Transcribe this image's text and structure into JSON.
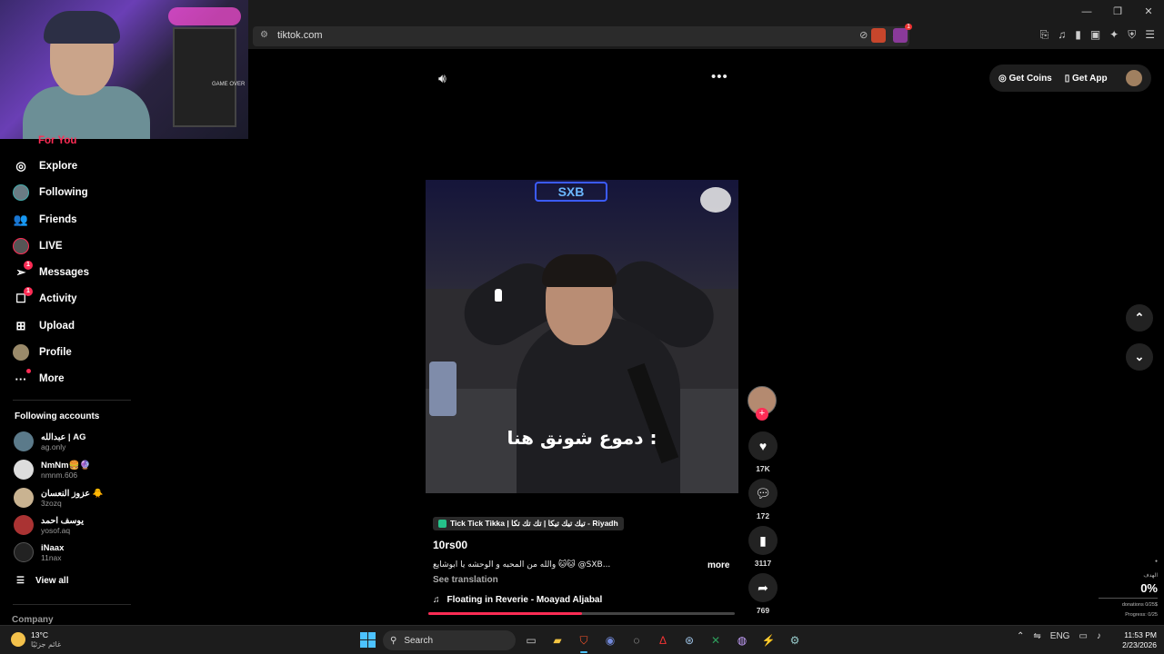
{
  "browser": {
    "url": "tiktok.com",
    "window_controls": [
      "—",
      "❐",
      "✕"
    ],
    "extension_badge": "1"
  },
  "webcam": {
    "label": "GAME OVER"
  },
  "sidebar": {
    "for_you": "For You",
    "items": [
      {
        "label": "Explore",
        "icon": "compass-icon"
      },
      {
        "label": "Following",
        "icon": "avatar"
      },
      {
        "label": "Friends",
        "icon": "friends-icon"
      },
      {
        "label": "LIVE",
        "icon": "live-icon"
      },
      {
        "label": "Messages",
        "icon": "messages-icon",
        "badge": "1"
      },
      {
        "label": "Activity",
        "icon": "activity-icon",
        "badge": "1"
      },
      {
        "label": "Upload",
        "icon": "upload-icon"
      },
      {
        "label": "Profile",
        "icon": "avatar"
      },
      {
        "label": "More",
        "icon": "more-icon"
      }
    ],
    "following_title": "Following accounts",
    "accounts": [
      {
        "name": "عبدالله | AG",
        "handle": "ag.only"
      },
      {
        "name": "NmNm🍔🔮",
        "handle": "nmnm.606"
      },
      {
        "name": "عزوز النعسان 🐥",
        "handle": "3zozq"
      },
      {
        "name": "يوسف احمد",
        "handle": "yosof.aq"
      },
      {
        "name": "iNaax",
        "handle": "11nax"
      }
    ],
    "view_all": "View all",
    "company": "Company"
  },
  "header": {
    "get_coins": "Get Coins",
    "get_app": "Get App"
  },
  "video": {
    "caption": "دموع شونق هنا :",
    "sign_text": "SXB",
    "music_tag": "Tick Tick Tikka | تيك تيك تيكا | تك تك تكا - Riyadh",
    "author": "10rs00",
    "description": "والله من المحبه و الوحشه يا ابوشايع 🐱🐱 @SXB...",
    "more": "more",
    "see_translation": "See translation",
    "song": "Floating in Reverie - Moayad Aljabal",
    "progress": 0.5
  },
  "actions": {
    "likes": "17K",
    "comments": "172",
    "saves": "3117",
    "shares": "769"
  },
  "donation": {
    "top_label": "●",
    "label": "الهدف",
    "percent": "0%",
    "donations": "donations 0/25$",
    "progress": "Progress: 0/25"
  },
  "taskbar": {
    "temperature": "13°C",
    "weather_desc": "غائم جزئيًا",
    "search": "Search",
    "lang": "ENG",
    "time": "11:53 PM",
    "date": "2/23/2026"
  }
}
